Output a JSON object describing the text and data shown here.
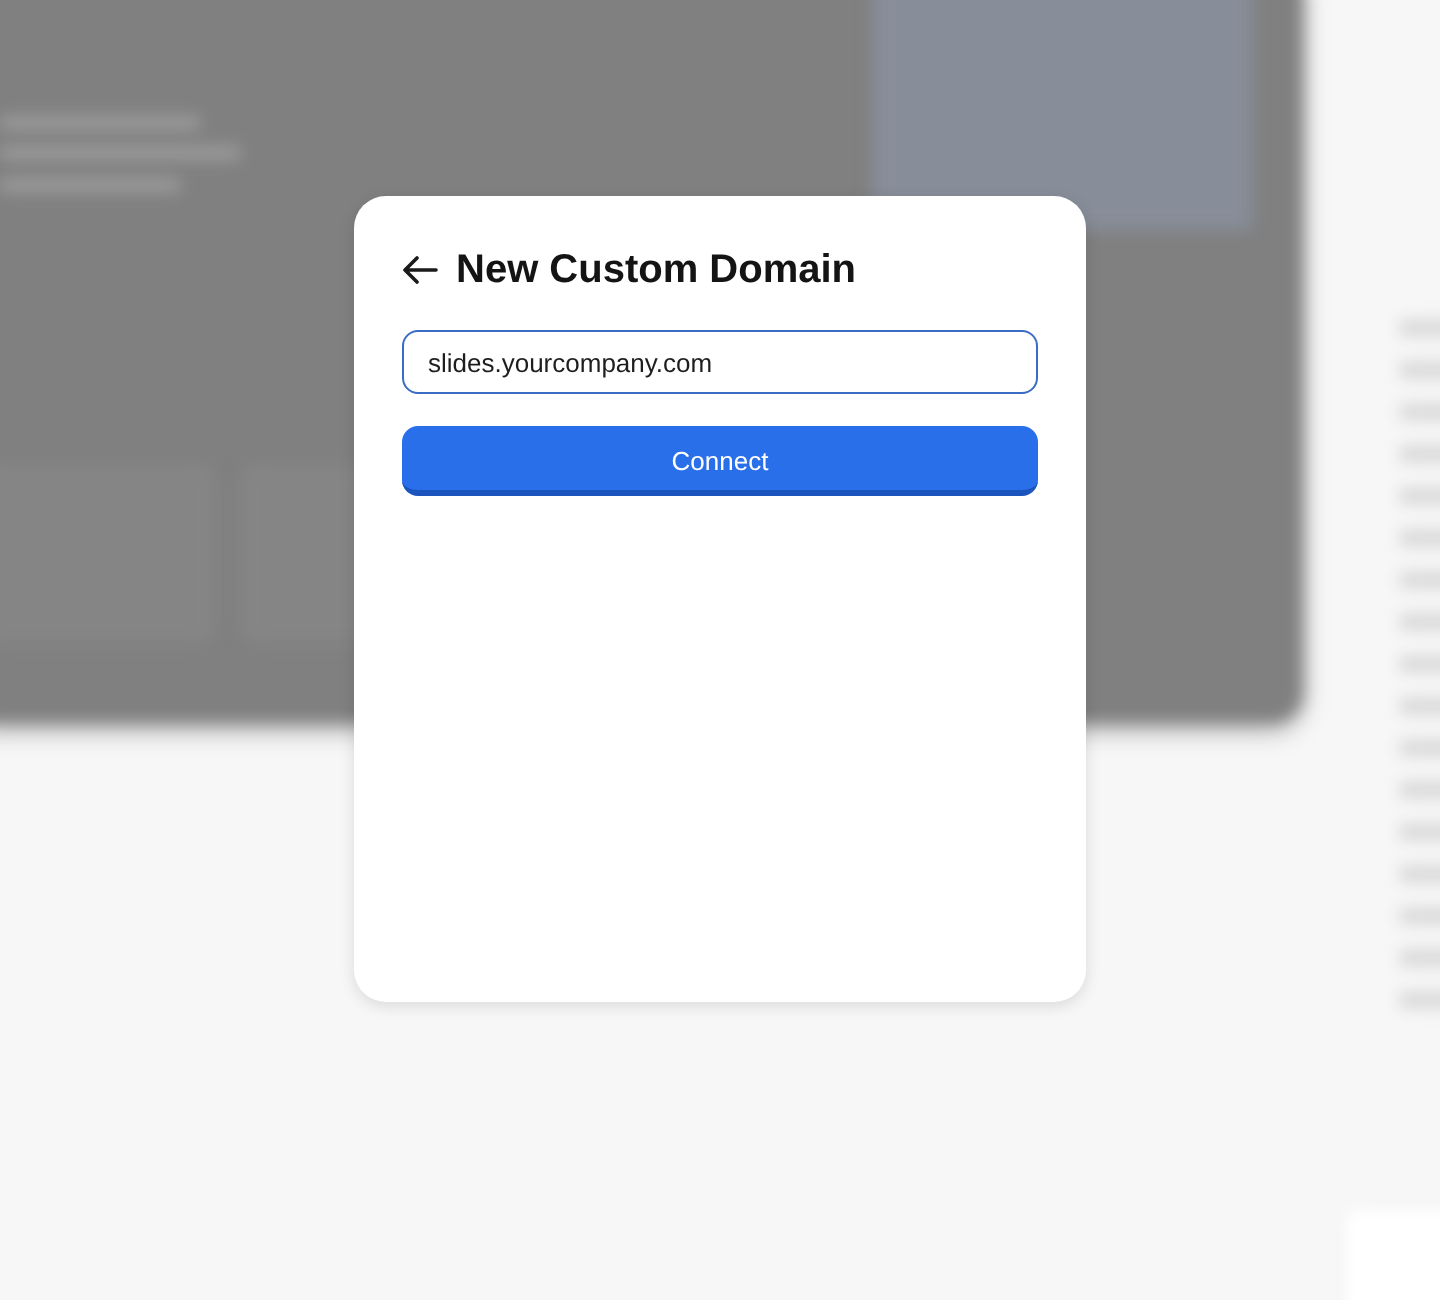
{
  "dialog": {
    "title": "New Custom Domain",
    "domain_field": {
      "value": "slides.yourcompany.com"
    },
    "buttons": [
      {
        "label": "Connect",
        "kind": "primary"
      }
    ]
  }
}
